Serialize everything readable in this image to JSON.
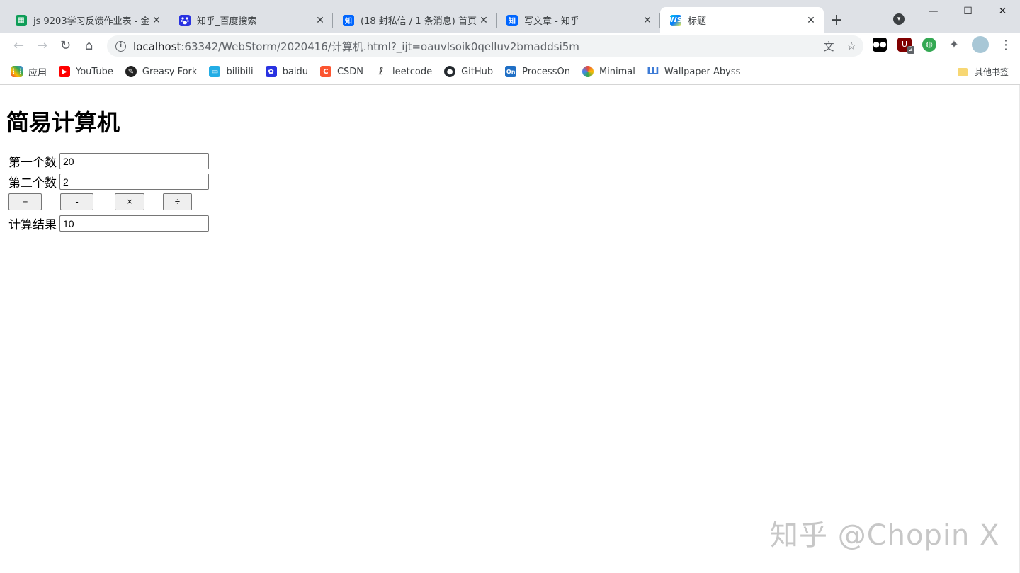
{
  "tabs": [
    {
      "title": "js 9203学习反馈作业表 - 金",
      "icon": "sheet-icon",
      "color": "#0f9d58"
    },
    {
      "title": "知乎_百度搜索",
      "icon": "baidu-icon",
      "color": "#2932e1"
    },
    {
      "title": "(18 封私信 / 1 条消息) 首页",
      "icon": "zhihu-icon",
      "color": "#0066ff"
    },
    {
      "title": "写文章 - 知乎",
      "icon": "zhihu-icon",
      "color": "#0066ff"
    },
    {
      "title": "标题",
      "icon": "webstorm-icon",
      "color": "#07c3f2",
      "active": true
    }
  ],
  "tab_glyphs": {
    "zhihu": "知",
    "webstorm": "WS",
    "sheet": "▦"
  },
  "newtab_label": "+",
  "window_controls": {
    "minimize": "—",
    "maximize": "☐",
    "close": "✕"
  },
  "address": {
    "host": "localhost",
    "rest": ":63342/WebStorm/2020416/计算机.html?_ijt=oauvlsoik0qelluv2bmaddsi5m"
  },
  "bookmarks": [
    {
      "label": "应用",
      "icon": "apps-icon",
      "color": "#ea4335"
    },
    {
      "label": "YouTube",
      "icon": "youtube-icon",
      "color": "#ff0000"
    },
    {
      "label": "Greasy Fork",
      "icon": "greasyfork-icon",
      "color": "#222222"
    },
    {
      "label": "bilibili",
      "icon": "bilibili-icon",
      "color": "#23ade5"
    },
    {
      "label": "baidu",
      "icon": "baidu-icon",
      "color": "#2932e1"
    },
    {
      "label": "CSDN",
      "icon": "csdn-icon",
      "color": "#fc5531"
    },
    {
      "label": "leetcode",
      "icon": "leetcode-icon",
      "color": "#444444"
    },
    {
      "label": "GitHub",
      "icon": "github-icon",
      "color": "#24292e"
    },
    {
      "label": "ProcessOn",
      "icon": "processon-icon",
      "color": "#1f6fc5"
    },
    {
      "label": "Minimal",
      "icon": "minimal-icon",
      "color": "#e94b3c"
    },
    {
      "label": "Wallpaper Abyss",
      "icon": "wallpaper-abyss-icon",
      "color": "#3d7bd6"
    }
  ],
  "bookmark_glyphs": {
    "apps": "⋮⋮",
    "csdn": "C",
    "processon": "On"
  },
  "other_bookmarks": "其他书签",
  "extension_badge": "2",
  "page": {
    "heading": "简易计算机",
    "first_label": "第一个数",
    "first_value": "20",
    "second_label": "第二个数",
    "second_value": "2",
    "ops": [
      "+",
      "-",
      "×",
      "÷"
    ],
    "result_label": "计算结果",
    "result_value": "10"
  },
  "watermark": "知乎 @Chopin X"
}
